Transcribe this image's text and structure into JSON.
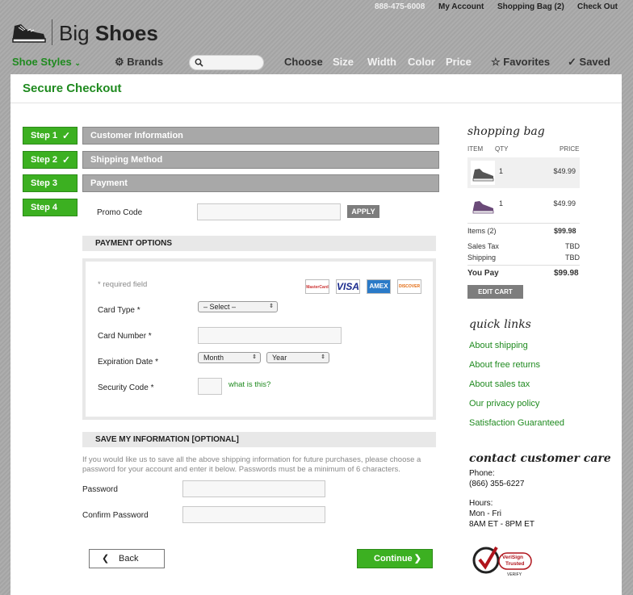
{
  "topbar": {
    "phone": "888-475-6008",
    "my_account": "My Account",
    "shopping_bag": "Shopping Bag (2)",
    "check_out": "Check Out"
  },
  "logo": {
    "light": "Big",
    "bold": "Shoes"
  },
  "nav": {
    "shoe_styles": "Shoe Styles",
    "brands": "Brands",
    "choose": "Choose",
    "size": "Size",
    "width": "Width",
    "color": "Color",
    "price": "Price",
    "favorites": "Favorites",
    "saved": "Saved"
  },
  "checkout": {
    "title": "Secure Checkout",
    "steps": [
      {
        "label": "Step 1",
        "title": "Customer Information",
        "done": true
      },
      {
        "label": "Step 2",
        "title": "Shipping Method",
        "done": true
      },
      {
        "label": "Step 3",
        "title": "Payment",
        "done": false
      },
      {
        "label": "Step 4",
        "title": "",
        "done": false
      }
    ],
    "promo_label": "Promo Code",
    "apply_label": "APPLY",
    "payment_options_heading": "PAYMENT OPTIONS",
    "required_note": "* required field",
    "cards": [
      "MasterCard",
      "VISA",
      "AMEX",
      "DISCOVER"
    ],
    "card_type_label": "Card Type *",
    "card_type_value": "– Select –",
    "card_number_label": "Card Number *",
    "expiration_label": "Expiration Date *",
    "month_value": "Month",
    "year_value": "Year",
    "security_label": "Security Code *",
    "what_is_this": "what is this?",
    "save_info_heading": "SAVE MY INFORMATION [OPTIONAL]",
    "save_note_1": "If you would like us to save all the above shipping information for future purchases, please choose a",
    "save_note_2": "password for your account and enter it below. Passwords must be a minimum of 6 characters.",
    "password_label": "Password",
    "confirm_password_label": "Confirm Password",
    "back_label": "Back",
    "continue_label": "Continue"
  },
  "bag": {
    "heading": "shopping bag",
    "col_item": "ITEM",
    "col_qty": "QTY",
    "col_price": "PRICE",
    "items": [
      {
        "qty": "1",
        "price": "$49.99",
        "color": "#555555"
      },
      {
        "qty": "1",
        "price": "$49.99",
        "color": "#6a4a78"
      }
    ],
    "items_label": "Items (2)",
    "items_total": "$99.98",
    "tax_label": "Sales Tax",
    "tax_value": "TBD",
    "shipping_label": "Shipping",
    "shipping_value": "TBD",
    "you_pay_label": "You Pay",
    "you_pay_value": "$99.98",
    "edit_cart": "EDIT CART"
  },
  "quick_links": {
    "heading": "quick links",
    "links": [
      "About shipping",
      "About free returns",
      "About sales tax",
      "Our privacy policy",
      "Satisfaction Guaranteed"
    ]
  },
  "contact": {
    "heading": "contact customer care",
    "phone_label": "Phone:",
    "phone": "(866) 355-6227",
    "hours_label": "Hours:",
    "days": "Mon - Fri",
    "hours": "8AM ET - 8PM ET"
  },
  "verisign": {
    "line1": "VeriSign",
    "line2": "Trusted",
    "line3": "VERIFY"
  },
  "colors": {
    "brand_green": "#3cb021",
    "link_green": "#1f8a1f",
    "step_gray": "#a8a8a8"
  }
}
